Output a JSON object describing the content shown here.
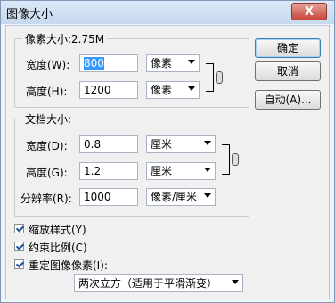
{
  "dialog": {
    "title": "图像大小",
    "close_label": "X"
  },
  "pixel_dimensions": {
    "label": "像素大小:2.75M",
    "width": {
      "label": "宽度(W):",
      "value": "800",
      "unit": "像素"
    },
    "height": {
      "label": "高度(H):",
      "value": "1200",
      "unit": "像素"
    }
  },
  "document_size": {
    "label": "文档大小:",
    "width": {
      "label": "宽度(D):",
      "value": "0.8",
      "unit": "厘米"
    },
    "height": {
      "label": "高度(G):",
      "value": "1.2",
      "unit": "厘米"
    },
    "resolution": {
      "label": "分辨率(R):",
      "value": "1000",
      "unit": "像素/厘米"
    }
  },
  "buttons": {
    "ok": "确定",
    "cancel": "取消",
    "auto": "自动(A)..."
  },
  "options": {
    "scale_styles": {
      "label": "缩放样式(Y)",
      "checked": true
    },
    "constrain_proportions": {
      "label": "约束比例(C)",
      "checked": true
    },
    "resample": {
      "label": "重定图像像素(I):",
      "checked": true
    }
  },
  "resample_method": {
    "value": "两次立方（适用于平滑渐变）"
  }
}
